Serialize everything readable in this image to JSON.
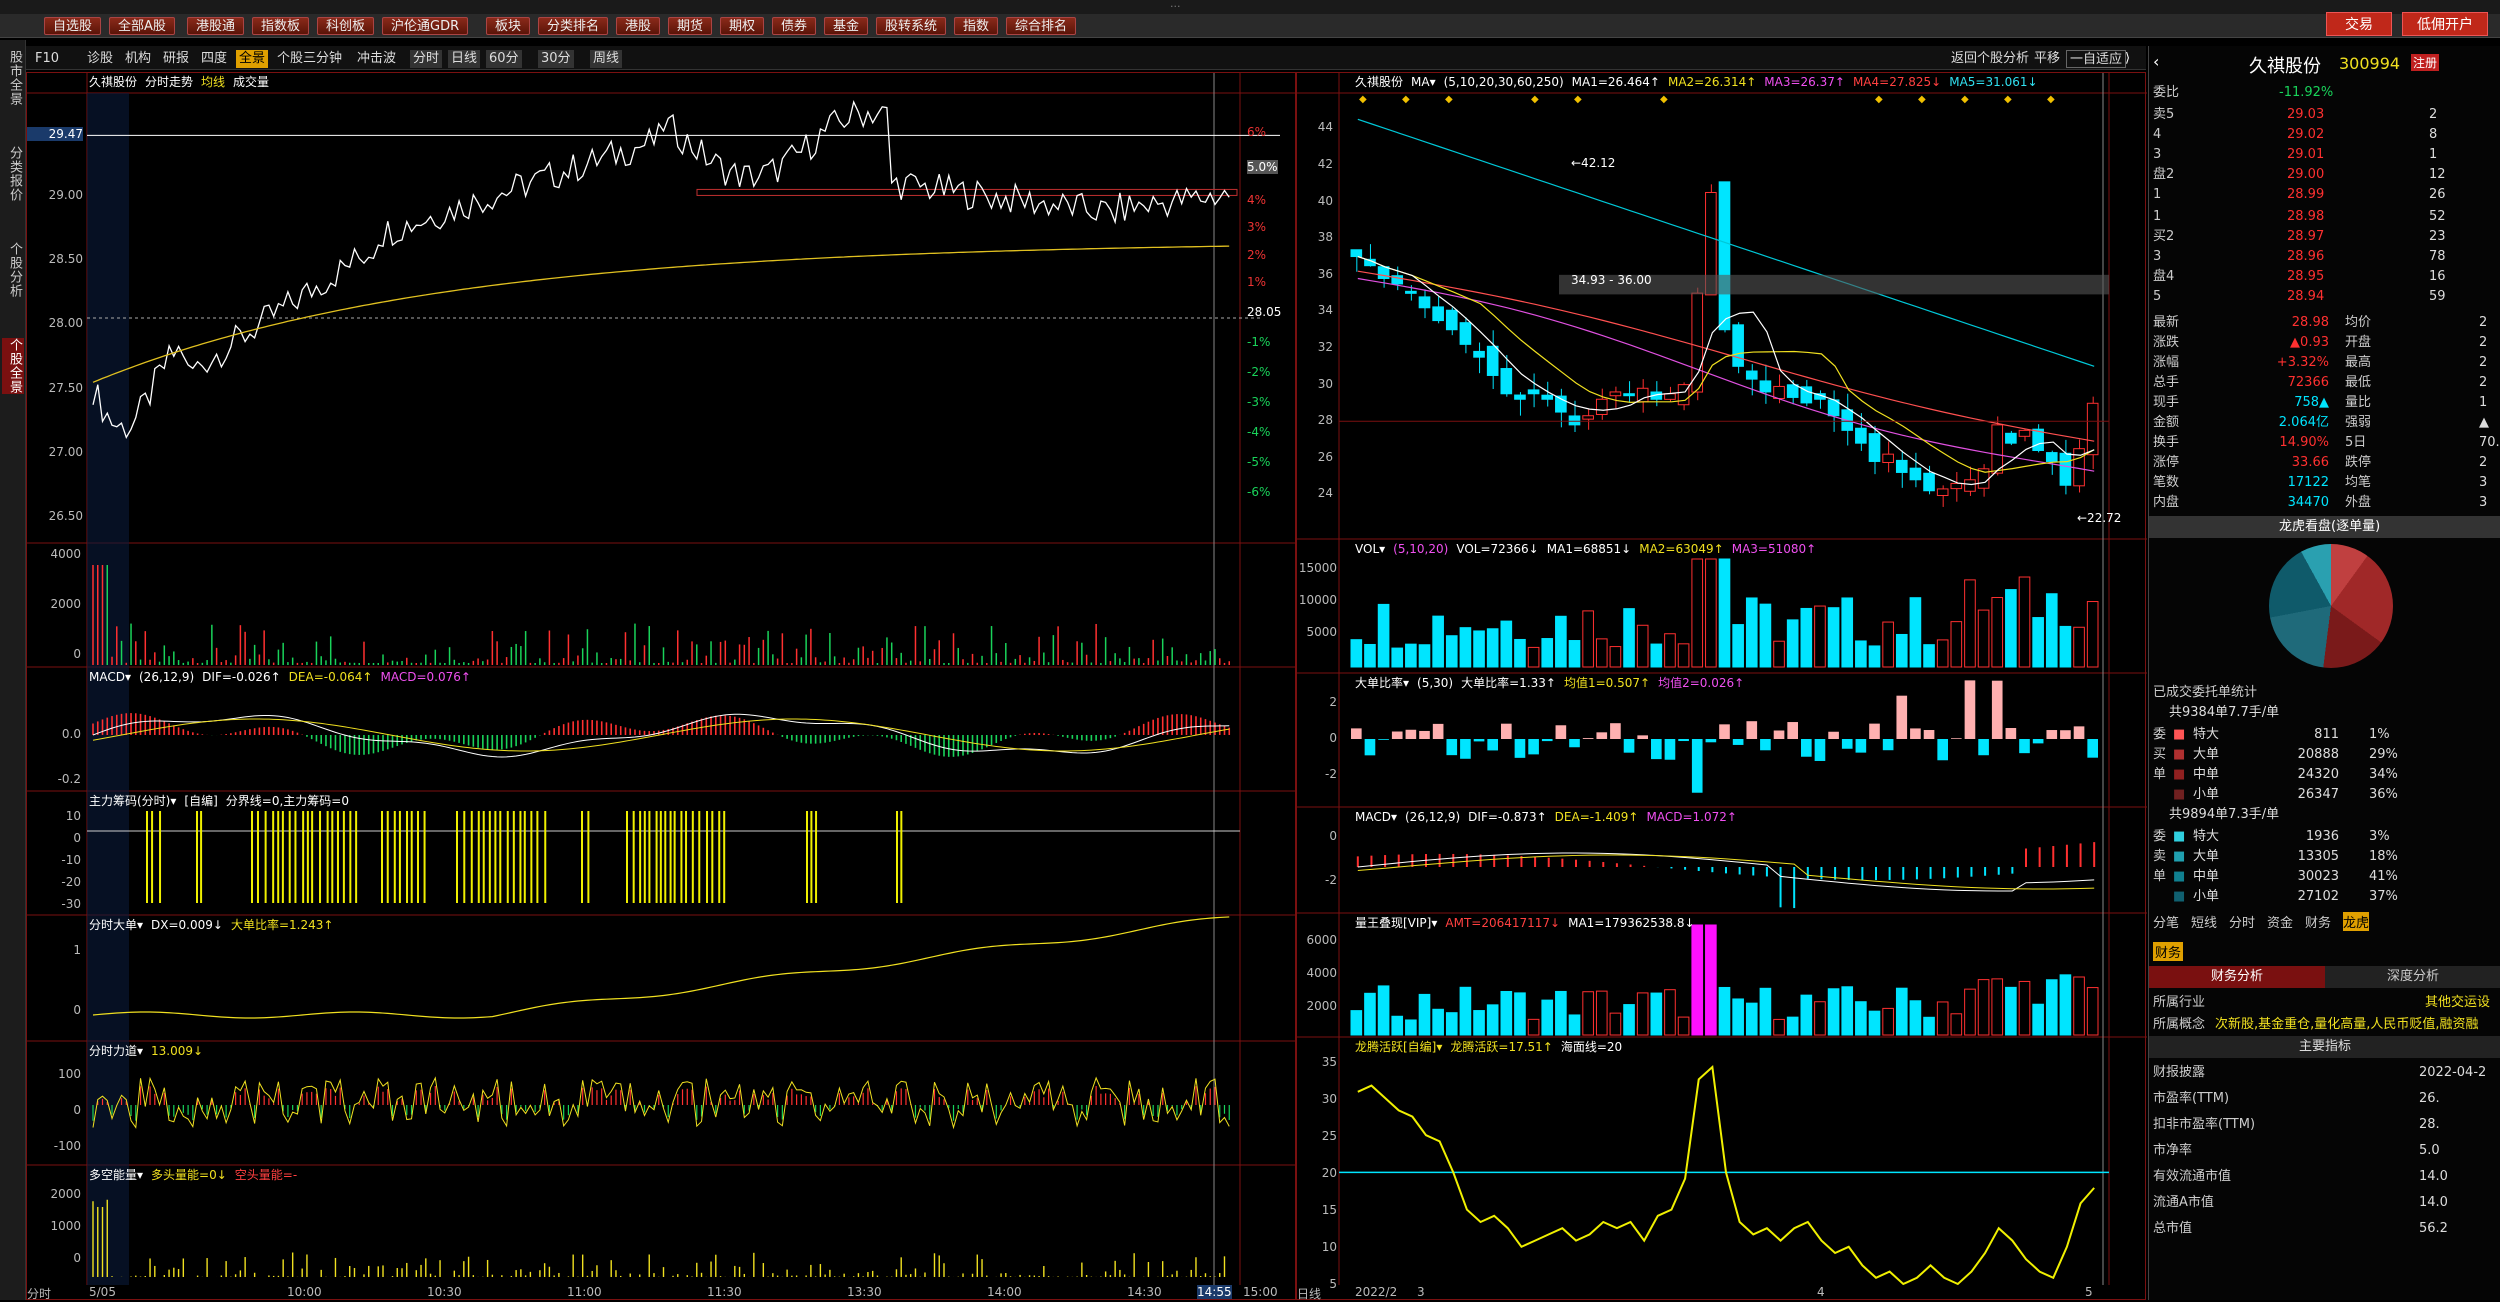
{
  "window": {
    "title": "···"
  },
  "menu": [
    "自选股",
    "全部A股",
    "港股通",
    "指数板",
    "科创板",
    "沪伦通GDR",
    "板块",
    "分类排名",
    "港股",
    "期货",
    "期权",
    "债券",
    "基金",
    "股转系统",
    "指数",
    "综合排名"
  ],
  "menu_right": {
    "trade": "交易",
    "open_account": "低佣开户"
  },
  "sidebar": [
    "股市全景",
    "分类报价",
    "个股分析",
    "个股全景"
  ],
  "toolbar": {
    "items": [
      "F10",
      "诊股",
      "机构",
      "研报",
      "四度",
      "全景",
      "个股三分钟",
      "冲击波"
    ],
    "period": [
      "分时",
      "日线",
      "60分",
      "30分",
      "周线"
    ],
    "selected": "全景"
  },
  "rtoolbar": {
    "back": "返回个股分析",
    "flat": "平移",
    "auto": "一自适应"
  },
  "intraday": {
    "title": "久祺股份",
    "sub": "分时走势",
    "ind": "均线",
    "vol": "成交量",
    "prices": [
      "29.47",
      "29.00",
      "28.50",
      "28.00",
      "27.50",
      "27.00",
      "26.50"
    ],
    "pcts": [
      "6%",
      "5.0%",
      "4%",
      "3%",
      "2%",
      "1%",
      "28.05",
      "-1%",
      "-2%",
      "-3%",
      "-4%",
      "-5%",
      "-6%"
    ],
    "vol_ticks": [
      "4000",
      "2000",
      "0"
    ],
    "macd": {
      "name": "MACD",
      "params": "(26,12,9)",
      "dif": "DIF=-0.026↑",
      "dea": "DEA=-0.064↑",
      "macd": "MACD=0.076↑",
      "ticks": [
        "0.0",
        "-0.2"
      ]
    },
    "zl": {
      "name": "主力筹码(分时)",
      "sub": "[自编]",
      "params": "分界线=0,主力筹码=0",
      "ticks": [
        "10",
        "0",
        "-10",
        "-20",
        "-30"
      ]
    },
    "dd": {
      "name": "分时大单",
      "dx": "DX=0.009↓",
      "ratio": "大单比率=1.243↑",
      "ticks": [
        "1",
        "0"
      ]
    },
    "ld": {
      "name": "分时力道",
      "val": "13.009↓",
      "ticks": [
        "100",
        "0",
        "-100"
      ]
    },
    "dk": {
      "name": "多空能量",
      "val": "多头量能=0↓",
      "val2": "空头量能=-",
      "ticks": [
        "2000",
        "1000",
        "0"
      ]
    },
    "times": [
      "分时",
      "5/05",
      "10:00",
      "10:30",
      "11:00",
      "11:30",
      "13:30",
      "14:00",
      "14:30",
      "14:55",
      "15:00"
    ]
  },
  "kline": {
    "title": "久祺股份",
    "ma": "MA",
    "params": "(5,10,20,30,60,250)",
    "ma1": "MA1=26.464↑",
    "ma2": "MA2=26.314↑",
    "ma3": "MA3=26.37↑",
    "ma4": "MA4=27.825↓",
    "ma5": "MA5=31.061↓",
    "price_ticks": [
      "44",
      "42",
      "40",
      "38",
      "36",
      "34",
      "32",
      "30",
      "28",
      "26",
      "24"
    ],
    "hi": "42.12",
    "lo": "22.72",
    "band": "34.93 - 36.00",
    "vol": {
      "name": "VOL",
      "params": "(5,10,20)",
      "v": "VOL=72366↓",
      "ma1": "MA1=68851↓",
      "ma2": "MA2=63049↑",
      "ma3": "MA3=51080↑",
      "ticks": [
        "15000",
        "10000",
        "5000"
      ]
    },
    "dbl": {
      "name": "大单比率",
      "params": "(5,30)",
      "v": "大单比率=1.33↑",
      "j1": "均值1=0.507↑",
      "j2": "均值2=0.026↑",
      "ticks": [
        "2",
        "0",
        "-2"
      ]
    },
    "macd": {
      "name": "MACD",
      "params": "(26,12,9)",
      "dif": "DIF=-0.873↑",
      "dea": "DEA=-1.409↑",
      "macd": "MACD=1.072↑",
      "ticks": [
        "0",
        "-2"
      ]
    },
    "lw": {
      "name": "量王叠现[VIP]",
      "amt": "AMT=206417117↓",
      "ma1": "MA1=179362538.8↓",
      "ticks": [
        "6000",
        "4000",
        "2000"
      ]
    },
    "lt": {
      "name": "龙腾活跃[自编]",
      "v": "龙腾活跃=17.51↑",
      "sea": "海面线=20",
      "ticks": [
        "35",
        "30",
        "25",
        "20",
        "15",
        "10",
        "5"
      ]
    },
    "dates": [
      "日线",
      "2022/2",
      "3",
      "4",
      "5"
    ]
  },
  "quote": {
    "name": "久祺股份",
    "code": "300994",
    "tag": "注册",
    "webi_label": "委比",
    "webi": "-11.92%",
    "asks": [
      [
        "卖5",
        "29.03",
        "2"
      ],
      [
        "4",
        "29.02",
        "8"
      ],
      [
        "3",
        "29.01",
        "1"
      ],
      [
        "盘2",
        "29.00",
        "12"
      ],
      [
        "1",
        "28.99",
        "26"
      ]
    ],
    "bids": [
      [
        "1",
        "28.98",
        "52"
      ],
      [
        "买2",
        "28.97",
        "23"
      ],
      [
        "3",
        "28.96",
        "78"
      ],
      [
        "盘4",
        "28.95",
        "16"
      ],
      [
        "5",
        "28.94",
        "59"
      ]
    ],
    "stats": [
      [
        "最新",
        "28.98",
        "均价",
        "2"
      ],
      [
        "涨跌",
        "▲0.93",
        "开盘",
        "2"
      ],
      [
        "涨幅",
        "+3.32%",
        "最高",
        "2"
      ],
      [
        "总手",
        "72366",
        "最低",
        "2"
      ],
      [
        "现手",
        "758▲",
        "量比",
        "1"
      ],
      [
        "金额",
        "2.064亿",
        "强弱",
        "▲"
      ],
      [
        "换手",
        "14.90%",
        "5日",
        "70."
      ],
      [
        "涨停",
        "33.66",
        "跌停",
        "2"
      ],
      [
        "笔数",
        "17122",
        "均笔",
        "3"
      ],
      [
        "内盘",
        "34470",
        "外盘",
        "3"
      ]
    ],
    "lh_title": "龙虎看盘(逐单量)",
    "entrust": "已成交委托单统计",
    "buy_total": "共9384单7.7手/单",
    "buy": [
      [
        "委",
        "特大",
        "811",
        "1%"
      ],
      [
        "买",
        "大单",
        "20888",
        "29%"
      ],
      [
        "单",
        "中单",
        "24320",
        "34%"
      ],
      [
        "",
        "小单",
        "26347",
        "36%"
      ]
    ],
    "sell_total": "共9894单7.3手/单",
    "sell": [
      [
        "委",
        "特大",
        "1936",
        "3%"
      ],
      [
        "卖",
        "大单",
        "13305",
        "18%"
      ],
      [
        "单",
        "中单",
        "30023",
        "41%"
      ],
      [
        "",
        "小单",
        "27102",
        "37%"
      ]
    ],
    "tabs": [
      "分笔",
      "短线",
      "分时",
      "资金",
      "财务",
      "龙虎"
    ],
    "fin_tab": "财务",
    "fin_sub": [
      "财务分析",
      "深度分析"
    ],
    "industry_l": "所属行业",
    "industry": "其他交运设",
    "concept_l": "所属概念",
    "concept": "次新股,基金重仓,量化高量,人民币贬值,融资融",
    "key": "主要指标",
    "fin": [
      [
        "财报披露",
        "2022-04-2"
      ],
      [
        "市盈率(TTM)",
        "26."
      ],
      [
        "扣非市盈率(TTM)",
        "28."
      ],
      [
        "市净率",
        "5.0"
      ],
      [
        "有效流通市值",
        "14.0"
      ],
      [
        "流通A市值",
        "14.0"
      ],
      [
        "总市值",
        "56.2"
      ]
    ]
  },
  "colors": {
    "up": "#ff3030",
    "down": "#19d35a",
    "cyan": "#00e5ff"
  }
}
